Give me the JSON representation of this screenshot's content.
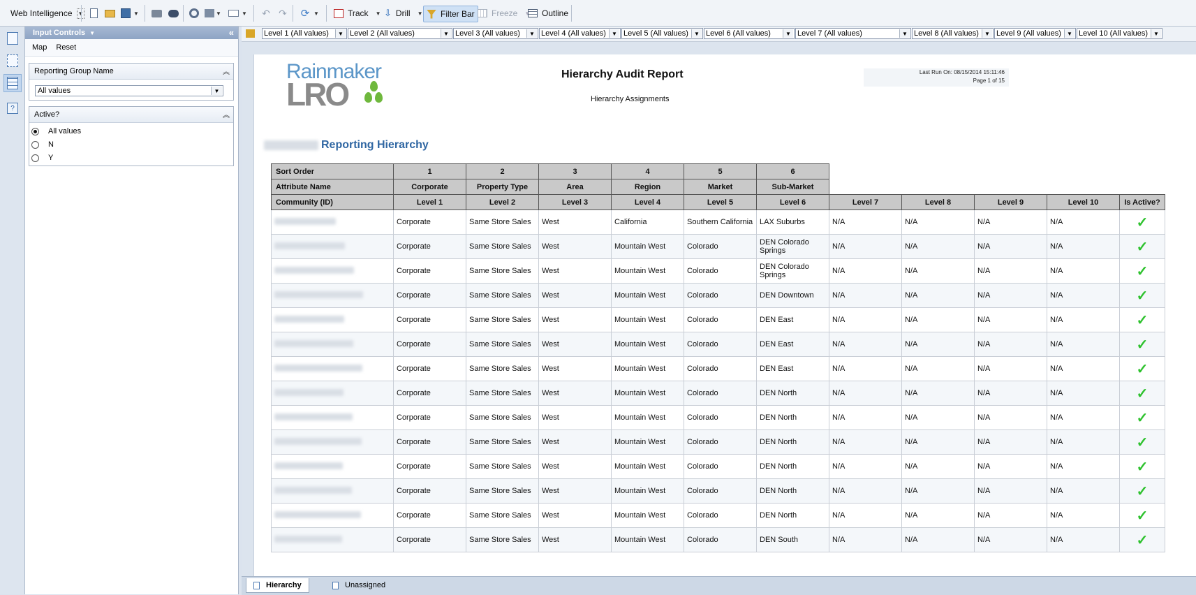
{
  "toolbar": {
    "app_name": "Web Intelligence",
    "track_label": "Track",
    "drill_label": "Drill",
    "filter_bar_label": "Filter Bar",
    "freeze_label": "Freeze",
    "outline_label": "Outline"
  },
  "panel": {
    "title": "Input Controls",
    "map_link": "Map",
    "reset_link": "Reset",
    "controls": [
      {
        "label": "Reporting Group Name",
        "selected_value": "All values"
      },
      {
        "label": "Active?",
        "options": [
          "All values",
          "N",
          "Y"
        ],
        "selected": "All values"
      }
    ]
  },
  "filter_bar": {
    "levels": [
      "Level 1 (All values)",
      "Level 2 (All values)",
      "Level 3 (All values)",
      "Level 4 (All values)",
      "Level 5 (All values)",
      "Level 6 (All values)",
      "Level 7 (All values)",
      "Level 8 (All values)",
      "Level 9 (All values)",
      "Level 10 (All values)"
    ]
  },
  "report": {
    "logo_top": "Rainmaker",
    "logo_bottom": "LRO",
    "title": "Hierarchy Audit Report",
    "subtitle": "Hierarchy Assignments",
    "last_run": "Last Run On: 08/15/2014 15:11:46",
    "page_info": "Page 1 of 15",
    "heading": "Reporting Hierarchy",
    "sort_order_label": "Sort Order",
    "sort_orders": [
      "1",
      "2",
      "3",
      "4",
      "5",
      "6"
    ],
    "attribute_name_label": "Attribute Name",
    "attribute_names": [
      "Corporate",
      "Property Type",
      "Area",
      "Region",
      "Market",
      "Sub-Market"
    ],
    "columns": [
      "Community (ID)",
      "Level 1",
      "Level 2",
      "Level 3",
      "Level 4",
      "Level 5",
      "Level 6",
      "Level 7",
      "Level 8",
      "Level 9",
      "Level 10",
      "Is Active?"
    ],
    "rows": [
      [
        "Corporate",
        "Same Store Sales",
        "West",
        "California",
        "Southern California",
        "LAX Suburbs",
        "N/A",
        "N/A",
        "N/A",
        "N/A"
      ],
      [
        "Corporate",
        "Same Store Sales",
        "West",
        "Mountain West",
        "Colorado",
        "DEN Colorado Springs",
        "N/A",
        "N/A",
        "N/A",
        "N/A"
      ],
      [
        "Corporate",
        "Same Store Sales",
        "West",
        "Mountain West",
        "Colorado",
        "DEN Colorado Springs",
        "N/A",
        "N/A",
        "N/A",
        "N/A"
      ],
      [
        "Corporate",
        "Same Store Sales",
        "West",
        "Mountain West",
        "Colorado",
        "DEN Downtown",
        "N/A",
        "N/A",
        "N/A",
        "N/A"
      ],
      [
        "Corporate",
        "Same Store Sales",
        "West",
        "Mountain West",
        "Colorado",
        "DEN East",
        "N/A",
        "N/A",
        "N/A",
        "N/A"
      ],
      [
        "Corporate",
        "Same Store Sales",
        "West",
        "Mountain West",
        "Colorado",
        "DEN East",
        "N/A",
        "N/A",
        "N/A",
        "N/A"
      ],
      [
        "Corporate",
        "Same Store Sales",
        "West",
        "Mountain West",
        "Colorado",
        "DEN East",
        "N/A",
        "N/A",
        "N/A",
        "N/A"
      ],
      [
        "Corporate",
        "Same Store Sales",
        "West",
        "Mountain West",
        "Colorado",
        "DEN North",
        "N/A",
        "N/A",
        "N/A",
        "N/A"
      ],
      [
        "Corporate",
        "Same Store Sales",
        "West",
        "Mountain West",
        "Colorado",
        "DEN North",
        "N/A",
        "N/A",
        "N/A",
        "N/A"
      ],
      [
        "Corporate",
        "Same Store Sales",
        "West",
        "Mountain West",
        "Colorado",
        "DEN North",
        "N/A",
        "N/A",
        "N/A",
        "N/A"
      ],
      [
        "Corporate",
        "Same Store Sales",
        "West",
        "Mountain West",
        "Colorado",
        "DEN North",
        "N/A",
        "N/A",
        "N/A",
        "N/A"
      ],
      [
        "Corporate",
        "Same Store Sales",
        "West",
        "Mountain West",
        "Colorado",
        "DEN North",
        "N/A",
        "N/A",
        "N/A",
        "N/A"
      ],
      [
        "Corporate",
        "Same Store Sales",
        "West",
        "Mountain West",
        "Colorado",
        "DEN North",
        "N/A",
        "N/A",
        "N/A",
        "N/A"
      ],
      [
        "Corporate",
        "Same Store Sales",
        "West",
        "Mountain West",
        "Colorado",
        "DEN South",
        "N/A",
        "N/A",
        "N/A",
        "N/A"
      ]
    ],
    "active_icon": "checkmark-icon",
    "active_color": "#2ec22e"
  },
  "tabs": [
    "Hierarchy",
    "Unassigned"
  ],
  "colors": {
    "accent": "#3067a3",
    "header_gray": "#c9c9c9"
  }
}
